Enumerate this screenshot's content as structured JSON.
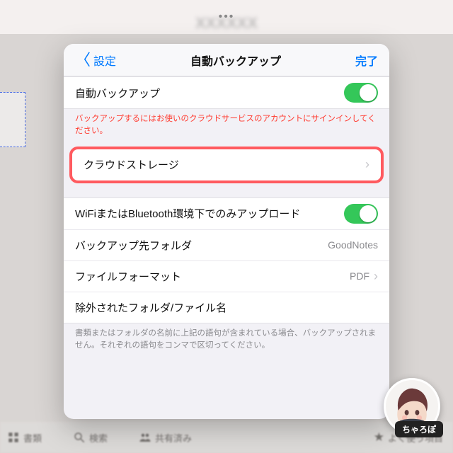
{
  "background": {
    "ellipsis": "•••",
    "tabs": {
      "documents": "書類",
      "search": "検索",
      "shared": "共有済み",
      "favorites": "よく使う項目"
    }
  },
  "modal": {
    "back_label": "設定",
    "title": "自動バックアップ",
    "done": "完了"
  },
  "rows": {
    "auto_backup": "自動バックアップ",
    "signin_warning": "バックアップするにはお使いのクラウドサービスのアカウントにサインインしてください。",
    "cloud_storage": "クラウドストレージ",
    "wifi_bt_only": "WiFiまたはBluetooth環境下でのみアップロード",
    "dest_folder_label": "バックアップ先フォルダ",
    "dest_folder_value": "GoodNotes",
    "file_format_label": "ファイルフォーマット",
    "file_format_value": "PDF",
    "excluded_label": "除外されたフォルダ/ファイル名",
    "excluded_note": "書類またはフォルダの名前に上記の語句が含まれている場合、バックアップされません。それぞれの語句をコンマで区切ってください。"
  },
  "avatar": {
    "name": "ちゃろぽ"
  }
}
